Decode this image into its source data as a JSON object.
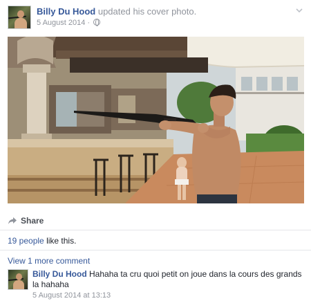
{
  "post": {
    "author": "Billy Du Hood",
    "action": "updated his cover photo.",
    "date": "5 August 2014",
    "date_separator": "·",
    "audience_icon": "globe-icon",
    "menu_icon": "chevron-down-icon"
  },
  "actions": {
    "share_label": "Share",
    "share_icon": "share-arrow-icon"
  },
  "likes": {
    "people": "19 people",
    "suffix": "like this."
  },
  "comments": {
    "view_more_label": "View 1 more comment",
    "items": [
      {
        "author": "Billy Du Hood",
        "text": "Hahaha ta cru quoi petit on joue dans la cours des grands la hahaha",
        "timestamp": "5 August 2014 at 13:13"
      }
    ]
  },
  "colors": {
    "link": "#365899",
    "meta": "#90949c",
    "divider": "#e5e6e9"
  }
}
